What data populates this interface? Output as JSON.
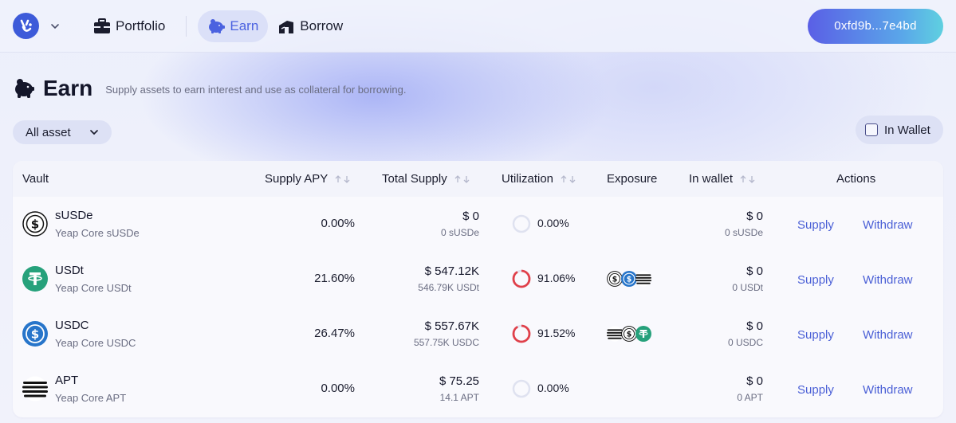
{
  "nav": {
    "items": [
      {
        "label": "Portfolio",
        "icon": "briefcase-icon"
      },
      {
        "label": "Earn",
        "icon": "piggy-bank-icon",
        "active": true
      },
      {
        "label": "Borrow",
        "icon": "borrow-icon"
      }
    ],
    "wallet_address": "0xfd9b...7e4bd"
  },
  "header": {
    "title": "Earn",
    "subtitle": "Supply assets to earn interest and use as collateral for borrowing."
  },
  "filters": {
    "asset_select": "All asset",
    "in_wallet_label": "In Wallet",
    "in_wallet_checked": false
  },
  "table": {
    "columns": {
      "vault": "Vault",
      "supply_apy": "Supply APY",
      "total_supply": "Total Supply",
      "utilization": "Utilization",
      "exposure": "Exposure",
      "in_wallet": "In wallet",
      "actions": "Actions"
    },
    "rows": [
      {
        "name": "sUSDe",
        "subtitle": "Yeap Core sUSDe",
        "icon": "susde-coin-icon",
        "apy": "0.00%",
        "total_usd": "$ 0",
        "total_tokens": "0 sUSDe",
        "utilization": "0.00%",
        "utilization_fraction": 0.0,
        "exposure": [],
        "wallet_usd": "$ 0",
        "wallet_tokens": "0 sUSDe",
        "supply": "Supply",
        "withdraw": "Withdraw"
      },
      {
        "name": "USDt",
        "subtitle": "Yeap Core USDt",
        "icon": "usdt-coin-icon",
        "apy": "21.60%",
        "total_usd": "$ 547.12K",
        "total_tokens": "546.79K USDt",
        "utilization": "91.06%",
        "utilization_fraction": 0.9106,
        "exposure": [
          "susde-coin-icon",
          "usdc-coin-icon",
          "apt-coin-icon"
        ],
        "wallet_usd": "$ 0",
        "wallet_tokens": "0 USDt",
        "supply": "Supply",
        "withdraw": "Withdraw"
      },
      {
        "name": "USDC",
        "subtitle": "Yeap Core USDC",
        "icon": "usdc-coin-icon",
        "apy": "26.47%",
        "total_usd": "$ 557.67K",
        "total_tokens": "557.75K USDC",
        "utilization": "91.52%",
        "utilization_fraction": 0.9152,
        "exposure": [
          "apt-coin-icon",
          "susde-coin-icon",
          "usdt-coin-icon"
        ],
        "wallet_usd": "$ 0",
        "wallet_tokens": "0 USDC",
        "supply": "Supply",
        "withdraw": "Withdraw"
      },
      {
        "name": "APT",
        "subtitle": "Yeap Core APT",
        "icon": "apt-coin-icon",
        "apy": "0.00%",
        "total_usd": "$ 75.25",
        "total_tokens": "14.1 APT",
        "utilization": "0.00%",
        "utilization_fraction": 0.0,
        "exposure": [],
        "wallet_usd": "$ 0",
        "wallet_tokens": "0 APT",
        "supply": "Supply",
        "withdraw": "Withdraw"
      }
    ]
  },
  "colors": {
    "accent": "#4b62e0",
    "link": "#4a5fd6",
    "utilization_ring": "#e0404a",
    "ring_track": "#dfe2f0",
    "usdt": "#26a17b",
    "usdc": "#2775ca"
  }
}
